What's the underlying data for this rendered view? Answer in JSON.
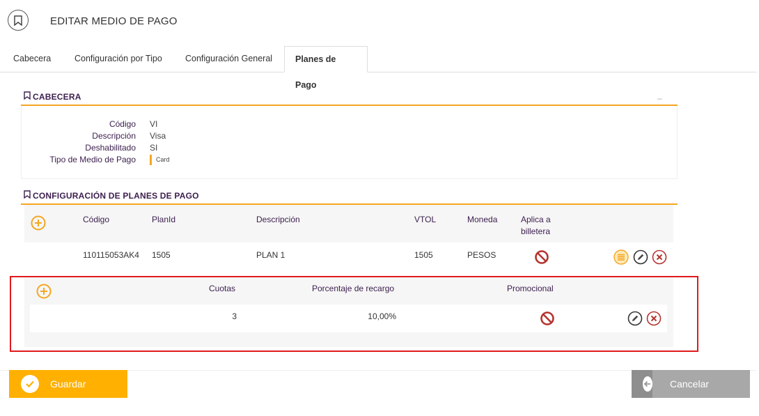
{
  "header": {
    "title": "EDITAR MEDIO DE PAGO",
    "icon": "bookmark-icon"
  },
  "tabs": [
    {
      "label": "Cabecera",
      "active": false
    },
    {
      "label": "Configuración por Tipo",
      "active": false
    },
    {
      "label": "Configuración General",
      "active": false
    },
    {
      "label": "Planes de Pago",
      "active": true
    }
  ],
  "cabecera": {
    "title": "CABECERA",
    "collapse": "–",
    "fields": [
      {
        "label": "Código",
        "value": "VI"
      },
      {
        "label": "Descripción",
        "value": "Visa"
      },
      {
        "label": "Deshabilitado",
        "value": "SI"
      },
      {
        "label": "Tipo de Medio de Pago",
        "value": "Card"
      }
    ]
  },
  "planes": {
    "title": "CONFIGURACIÓN DE PLANES DE PAGO",
    "columns": [
      "Código",
      "PlanId",
      "Descripción",
      "VTOL",
      "Moneda",
      "Aplica a",
      "billetera"
    ],
    "rows": [
      {
        "codigo": "110115053AK4",
        "planId": "1505",
        "descripcion": "PLAN 1",
        "vtol": "1505",
        "moneda": "PESOS",
        "aplica_billetera": false
      }
    ],
    "sub": {
      "columns": [
        "Cuotas",
        "Porcentaje de recargo",
        "Promocional"
      ],
      "rows": [
        {
          "cuotas": "3",
          "porcentaje": "10,00%",
          "promocional": false
        }
      ]
    }
  },
  "footer": {
    "save_label": "Guardar",
    "cancel_label": "Cancelar"
  },
  "colors": {
    "accent": "#f5a623",
    "button_save": "#ffb000",
    "button_cancel": "#a8a8a8",
    "deny": "#b5332e",
    "highlight_box": "#e0191c"
  }
}
